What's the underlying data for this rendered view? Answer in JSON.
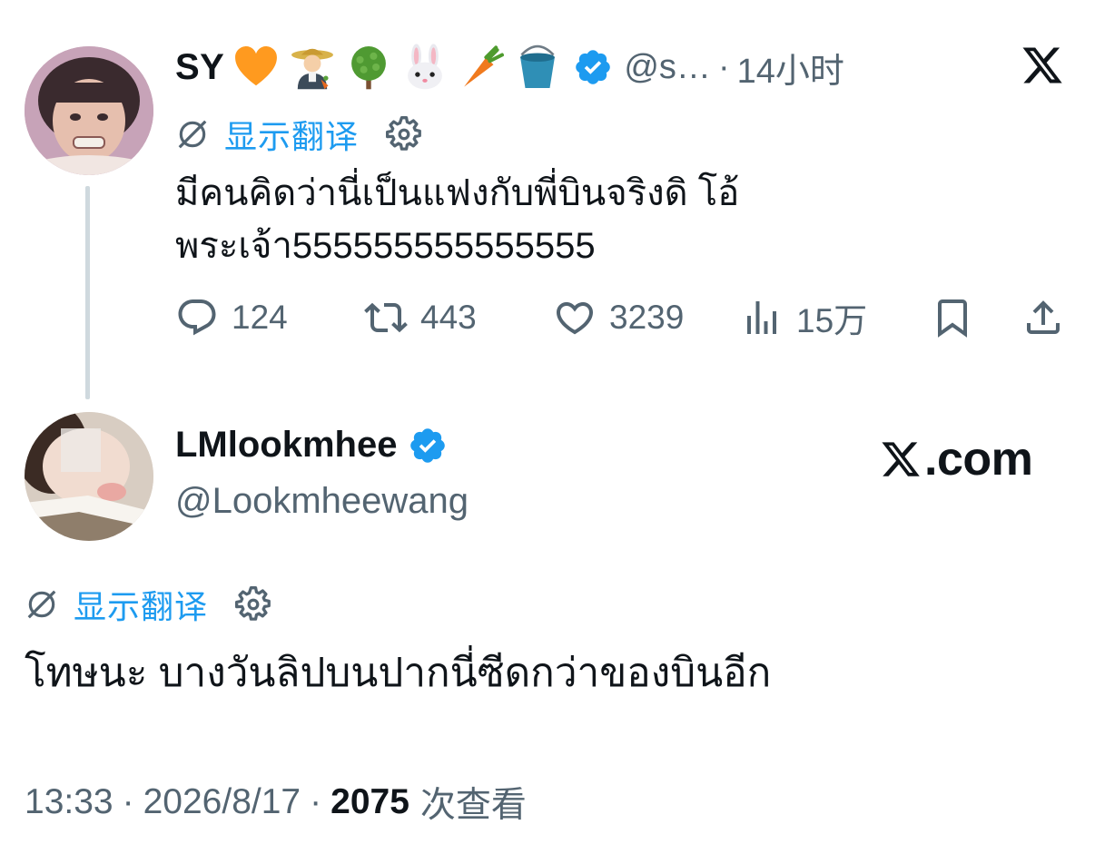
{
  "quoted_tweet": {
    "display_name": "SY",
    "handle": "@s…",
    "separator": "·",
    "time_ago": "14小时",
    "translate_label": "显示翻译",
    "text_line1": "มีคนคิดว่านี่เป็นแฟงกับพี่บินจริงดิ โอ้",
    "text_line2": "พระเจ้า555555555555555",
    "replies": "124",
    "reposts": "443",
    "likes": "3239",
    "views": "15万",
    "icons": [
      "orange-heart-icon",
      "farmer-icon",
      "tree-icon",
      "rabbit-icon",
      "carrot-icon",
      "bucket-icon",
      "verified-badge-icon"
    ]
  },
  "main_tweet": {
    "display_name": "LMlookmhee",
    "handle": "@Lookmheewang",
    "brand": ".com",
    "translate_label": "显示翻译",
    "text": "โทษนะ บางวันลิปบนปากนี่ซีดกว่าของบินอีก",
    "time": "13:33",
    "separator": "·",
    "date": "2026/8/17",
    "views_count": "2075",
    "views_label": "次查看"
  },
  "colors": {
    "accent": "#1d9bf0",
    "text": "#0f1419",
    "muted": "#536471",
    "thread_line": "#cfd9de"
  }
}
